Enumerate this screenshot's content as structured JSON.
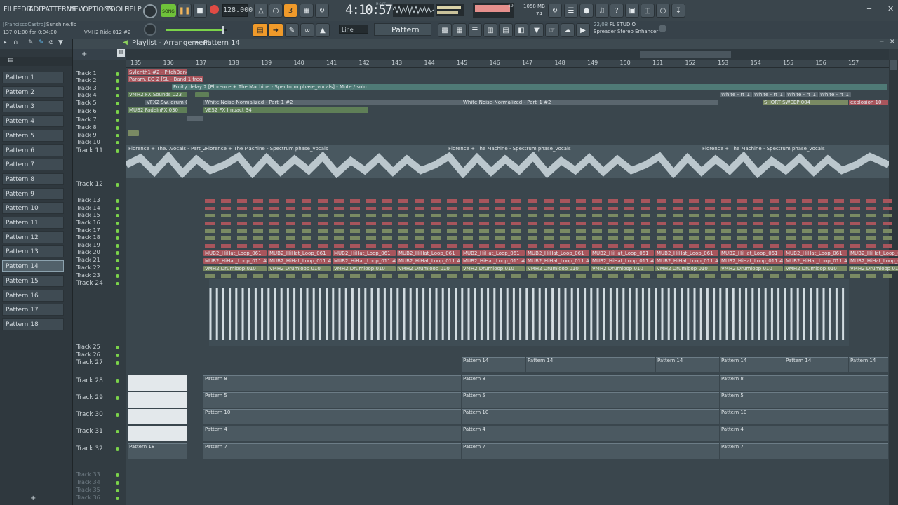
{
  "menu": [
    "FILE",
    "EDIT",
    "ADD",
    "PATTERNS",
    "VIEW",
    "OPTIONS",
    "TOOLS",
    "HELP"
  ],
  "transport": {
    "mode": "SONG",
    "tempo": "128.000",
    "time": "4:10:57",
    "time_label": "M:S:CS",
    "cpu": "1058 MB",
    "cpu2": "74",
    "voices": "19"
  },
  "hint": {
    "user": "[FranciscoCastro]",
    "file": "Sunshine.flp",
    "position": "137:01:00 for 0:04:00",
    "instrument": "VMH2 Ride 012 #2"
  },
  "snap": "Line",
  "pattern_selector": "Pattern 14",
  "news": {
    "date": "22/08",
    "title": "FL STUDIO |",
    "subtitle": "Spreader Stereo Enhancer"
  },
  "playlist": {
    "title": "Playlist - Arrangement",
    "pattern": "Pattern 14"
  },
  "patterns": [
    "Pattern 1",
    "Pattern 2",
    "Pattern 3",
    "Pattern 4",
    "Pattern 5",
    "Pattern 6",
    "Pattern 7",
    "Pattern 8",
    "Pattern 9",
    "Pattern 10",
    "Pattern 11",
    "Pattern 12",
    "Pattern 13",
    "Pattern 14",
    "Pattern 15",
    "Pattern 16",
    "Pattern 17",
    "Pattern 18"
  ],
  "bars": [
    "135",
    "136",
    "137",
    "138",
    "139",
    "140",
    "141",
    "142",
    "143",
    "144",
    "145",
    "146",
    "147",
    "148",
    "149",
    "150",
    "151",
    "152",
    "153",
    "154",
    "155",
    "156",
    "157"
  ],
  "tracks": [
    "Track 1",
    "Track 2",
    "Track 3",
    "Track 4",
    "Track 5",
    "Track 6",
    "Track 7",
    "Track 8",
    "Track 9",
    "Track 10",
    "Track 11",
    "Track 12",
    "Track 13",
    "Track 14",
    "Track 15",
    "Track 16",
    "Track 17",
    "Track 18",
    "Track 19",
    "Track 20",
    "Track 21",
    "Track 22",
    "Track 23",
    "Track 24",
    "Track 25",
    "Track 26",
    "Track 27",
    "Track 28",
    "Track 29",
    "Track 30",
    "Track 31",
    "Track 32",
    "Track 33",
    "Track 34",
    "Track 35",
    "Track 36"
  ],
  "clips": {
    "c1": "Sylenth1 #2 - PitchBend",
    "c2": "Param. EQ 2 [SL - Band 1 freq #2",
    "c3": "Fruity delay 2 [Florence + The Machine - Spectrum phase_vocals] - Mute / solo",
    "c4": "VMH2 FX Sounds 023",
    "c5": "VFX2 Sw. drum 09",
    "c6": "White Noise-Normalized - Part_1 #2",
    "c7": "White Noise-Normalized - Part_1 #2",
    "c8": "White - rt_1",
    "c9": "MUB2 FadeInFX 030",
    "c10": "VES2 FX Impact 34",
    "c11": "SHORT SWEEP 004",
    "c12": "explosion 10",
    "a1": "Florence + The...vocals - Part_2",
    "a2": "Florence + The Machine - Spectrum phase_vocals",
    "a3": "Florence + The Machine - Spectrum phase_vocals",
    "a4": "Florence + The Machine - Spectrum phase_vocals",
    "h1": "MUB2_HiHat_Loop_061",
    "h2": "MUB2_HiHat_Loop_011 #2",
    "d1": "VMH2 Drumloop 010",
    "p14": "Pattern 14",
    "p8": "Pattern 8",
    "p5": "Pattern 5",
    "p10": "Pattern 10",
    "p4": "Pattern 4",
    "p7": "Pattern 7",
    "p18": "Pattern 18"
  }
}
